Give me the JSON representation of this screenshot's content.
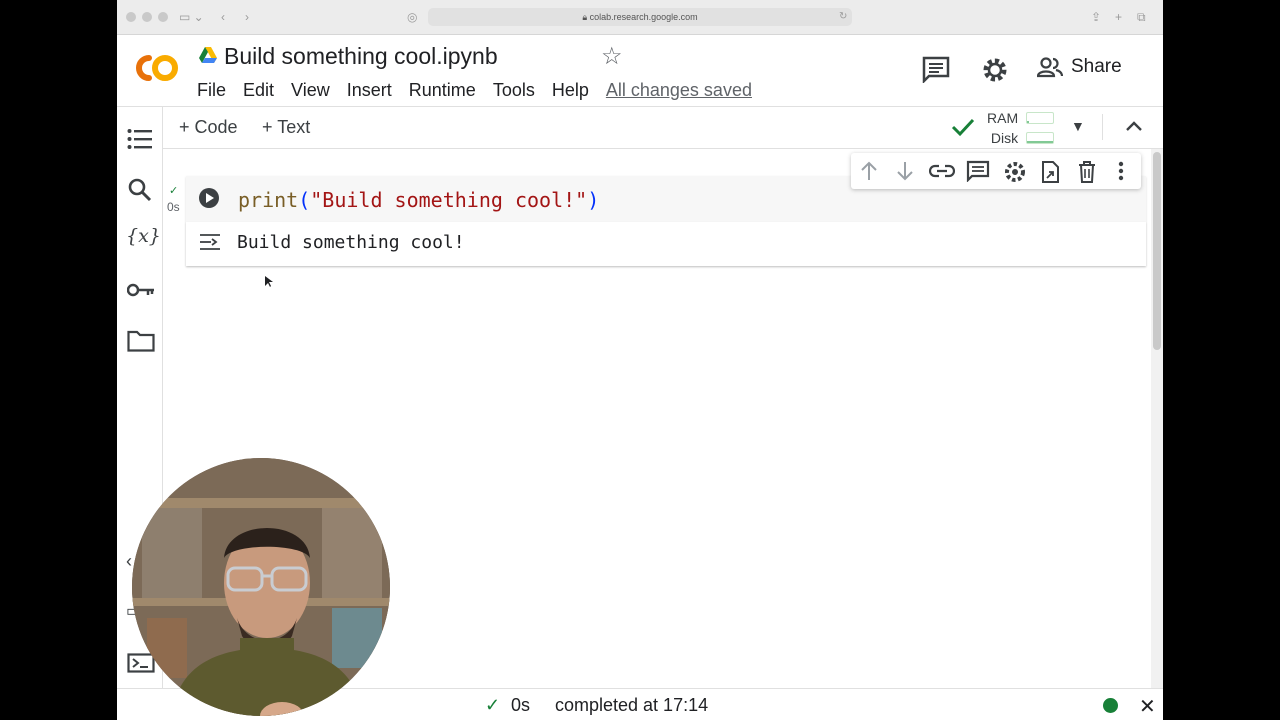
{
  "browser": {
    "url": "colab.research.google.com"
  },
  "header": {
    "notebook_title": "Build something cool.ipynb",
    "menu": [
      "File",
      "Edit",
      "View",
      "Insert",
      "Runtime",
      "Tools",
      "Help"
    ],
    "save_status": "All changes saved",
    "share_label": "Share"
  },
  "toolbar": {
    "add_code": "+ Code",
    "add_text": "+ Text",
    "ram_label": "RAM",
    "disk_label": "Disk"
  },
  "cell": {
    "code_fn": "print",
    "code_open": "(",
    "code_string": "\"Build something cool!\"",
    "code_close": ")",
    "exec_time": "0s",
    "output": "Build something cool!"
  },
  "status": {
    "elapsed": "0s",
    "completed": "completed at 17:14"
  },
  "colors": {
    "accent_green": "#188038",
    "logo_orange": "#f9ab00",
    "logo_dark_orange": "#e8710a"
  }
}
